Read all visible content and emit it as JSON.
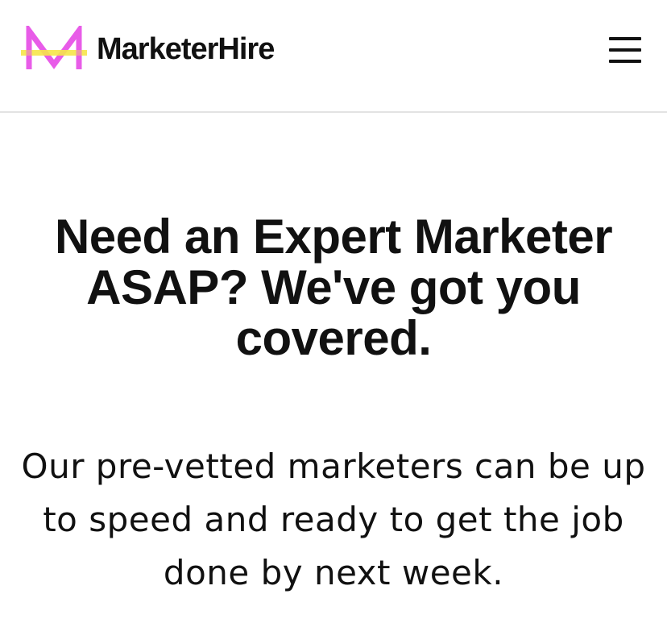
{
  "header": {
    "brand_name": "MarketerHire",
    "logo_icon": "marketerhire-m-logo",
    "menu_icon": "hamburger-menu-icon",
    "colors": {
      "logo_magenta": "#e85ce8",
      "logo_yellow": "#f6e64a",
      "divider": "#e3e3e3"
    }
  },
  "hero": {
    "title": "Need an Expert Marketer ASAP? We've got you covered.",
    "subtitle": "Our pre-vetted marketers can be up to speed and ready to get the job done by next week."
  }
}
